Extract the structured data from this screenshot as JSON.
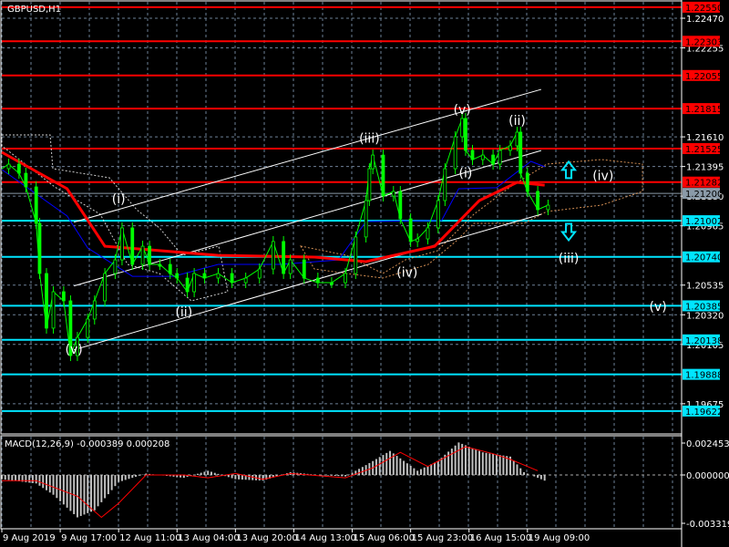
{
  "chart_data": [
    {
      "type": "line",
      "title": "GBPUSD,H1",
      "ylim": [
        1.195,
        1.2277
      ],
      "price_ticks": [
        "1.22470",
        "1.22255",
        "1.21610",
        "1.21395",
        "1.21180",
        "1.20965",
        "1.20535",
        "1.20320",
        "1.20105",
        "1.19675"
      ],
      "resistance_levels": [
        "1.22550",
        "1.22303",
        "1.22055",
        "1.21815",
        "1.21525",
        "1.21282"
      ],
      "support_levels": [
        "1.21002",
        "1.20740",
        "1.20385",
        "1.20138",
        "1.19888",
        "1.19622"
      ],
      "current_price": "1.21200",
      "time_labels": [
        {
          "bar": 0,
          "label": "9 Aug 2019"
        },
        {
          "bar": 17,
          "label": "9 Aug 17:00"
        },
        {
          "bar": 34,
          "label": "12 Aug 11:00"
        },
        {
          "bar": 51,
          "label": "13 Aug 04:00"
        },
        {
          "bar": 68,
          "label": "13 Aug 20:00"
        },
        {
          "bar": 85,
          "label": "14 Aug 13:00"
        },
        {
          "bar": 102,
          "label": "15 Aug 06:00"
        },
        {
          "bar": 119,
          "label": "15 Aug 23:00"
        },
        {
          "bar": 136,
          "label": "16 Aug 15:00"
        },
        {
          "bar": 153,
          "label": "19 Aug 09:00"
        }
      ],
      "price_series": {
        "name": "GBPUSD close",
        "color": "#00ff00",
        "points": [
          [
            0,
            1.21379
          ],
          [
            2,
            1.21412
          ],
          [
            5,
            1.21346
          ],
          [
            7,
            1.21247
          ],
          [
            10,
            1.20983
          ],
          [
            11,
            1.20619
          ],
          [
            13,
            1.20223
          ],
          [
            15,
            1.20487
          ],
          [
            18,
            1.20421
          ],
          [
            20,
            1.20024
          ],
          [
            22,
            1.20156
          ],
          [
            25,
            1.20289
          ],
          [
            27,
            1.20421
          ],
          [
            30,
            1.20619
          ],
          [
            33,
            1.20718
          ],
          [
            35,
            1.2095
          ],
          [
            38,
            1.20685
          ],
          [
            41,
            1.20817
          ],
          [
            43,
            1.20685
          ],
          [
            46,
            1.20685
          ],
          [
            49,
            1.20619
          ],
          [
            51,
            1.20586
          ],
          [
            54,
            1.20487
          ],
          [
            56,
            1.20619
          ],
          [
            59,
            1.20586
          ],
          [
            63,
            1.20619
          ],
          [
            67,
            1.20553
          ],
          [
            71,
            1.20586
          ],
          [
            75,
            1.20652
          ],
          [
            79,
            1.20851
          ],
          [
            82,
            1.20619
          ],
          [
            84,
            1.20718
          ],
          [
            88,
            1.20586
          ],
          [
            92,
            1.20553
          ],
          [
            96,
            1.20553
          ],
          [
            100,
            1.20619
          ],
          [
            103,
            1.20884
          ],
          [
            106,
            1.21148
          ],
          [
            107,
            1.21379
          ],
          [
            108,
            1.21478
          ],
          [
            111,
            1.21181
          ],
          [
            114,
            1.21214
          ],
          [
            116,
            1.21016
          ],
          [
            119,
            1.20851
          ],
          [
            121,
            1.2087
          ],
          [
            124,
            1.2095
          ],
          [
            127,
            1.21148
          ],
          [
            129,
            1.21379
          ],
          [
            132,
            1.21611
          ],
          [
            134,
            1.21743
          ],
          [
            135,
            1.21512
          ],
          [
            137,
            1.21445
          ],
          [
            140,
            1.21478
          ],
          [
            143,
            1.21412
          ],
          [
            145,
            1.21512
          ],
          [
            148,
            1.21545
          ],
          [
            150,
            1.21644
          ],
          [
            151,
            1.21346
          ],
          [
            153,
            1.21214
          ],
          [
            156,
            1.21082
          ],
          [
            159,
            1.21115
          ]
        ]
      },
      "ma_slow": {
        "color": "#ff0000",
        "points": [
          [
            0,
            1.21498
          ],
          [
            19,
            1.21234
          ],
          [
            30,
            1.20817
          ],
          [
            63,
            1.20751
          ],
          [
            91,
            1.20738
          ],
          [
            106,
            1.20705
          ],
          [
            126,
            1.20817
          ],
          [
            139,
            1.21148
          ],
          [
            150,
            1.2128
          ],
          [
            158,
            1.2126
          ]
        ]
      },
      "ma_fast": {
        "color": "#0000ff",
        "points": [
          [
            0,
            1.21373
          ],
          [
            19,
            1.21036
          ],
          [
            25,
            1.20804
          ],
          [
            38,
            1.20599
          ],
          [
            50,
            1.20599
          ],
          [
            63,
            1.20685
          ],
          [
            81,
            1.20685
          ],
          [
            98,
            1.20718
          ],
          [
            106,
            1.20996
          ],
          [
            128,
            1.21003
          ],
          [
            133,
            1.21234
          ],
          [
            144,
            1.21241
          ],
          [
            154,
            1.21432
          ],
          [
            158,
            1.21393
          ]
        ]
      },
      "wave_labels": [
        {
          "text": "(v)",
          "bar": 21,
          "price": 1.2007
        },
        {
          "text": "(i)",
          "bar": 34,
          "price": 1.2116
        },
        {
          "text": "(ii)",
          "bar": 53,
          "price": 1.2034
        },
        {
          "text": "(iii)",
          "bar": 107,
          "price": 1.216
        },
        {
          "text": "(iv)",
          "bar": 118,
          "price": 1.2063
        },
        {
          "text": "(v)",
          "bar": 134,
          "price": 1.2181
        },
        {
          "text": "(i)",
          "bar": 135,
          "price": 1.2135
        },
        {
          "text": "(ii)",
          "bar": 150,
          "price": 1.2173
        },
        {
          "text": "(iii)",
          "bar": 165,
          "price": 1.2073
        },
        {
          "text": "(iv)",
          "bar": 175,
          "price": 1.2133
        },
        {
          "text": "(v)",
          "bar": 191,
          "price": 1.2038
        }
      ],
      "channel_lines": [
        {
          "from": [
            21,
            1.20992
          ],
          "to": [
            157,
            1.21954
          ]
        },
        {
          "from": [
            21,
            1.20529
          ],
          "to": [
            157,
            1.21511
          ]
        },
        {
          "from": [
            21,
            1.20066
          ],
          "to": [
            157,
            1.21049
          ]
        }
      ],
      "arrows": [
        {
          "direction": "up",
          "bar": 165,
          "price": 1.2137,
          "color": "#00e5ff"
        },
        {
          "direction": "down",
          "bar": 165,
          "price": 1.2092,
          "color": "#00e5ff"
        }
      ]
    },
    {
      "type": "bar",
      "title": "MACD(12,26,9) -0.000389 0.000208",
      "ylim": [
        -0.003319,
        0.002453
      ],
      "tick_labels": [
        "0.002453",
        "0.000000",
        "-0.003319"
      ],
      "histogram": {
        "color": "#c0c0c0",
        "points": [
          [
            0,
            -0.0003
          ],
          [
            10,
            -0.0006
          ],
          [
            15,
            -0.0014
          ],
          [
            22,
            -0.003
          ],
          [
            27,
            -0.0025
          ],
          [
            34,
            -0.0005
          ],
          [
            42,
            0.0001
          ],
          [
            53,
            -0.0002
          ],
          [
            60,
            0.0003
          ],
          [
            68,
            -0.0003
          ],
          [
            76,
            -0.0004
          ],
          [
            84,
            0.0002
          ],
          [
            92,
            0.0
          ],
          [
            100,
            -0.0001
          ],
          [
            106,
            0.0007
          ],
          [
            113,
            0.0017
          ],
          [
            117,
            0.001
          ],
          [
            121,
            0.0003
          ],
          [
            127,
            0.001
          ],
          [
            133,
            0.0023
          ],
          [
            140,
            0.0016
          ],
          [
            148,
            0.0013
          ],
          [
            152,
            0.0002
          ],
          [
            158,
            -0.0004
          ]
        ]
      },
      "signal": {
        "color": "#ff0000",
        "points": [
          [
            0,
            -0.0004
          ],
          [
            10,
            -0.0004
          ],
          [
            22,
            -0.0015
          ],
          [
            29,
            -0.003
          ],
          [
            34,
            -0.002
          ],
          [
            42,
            0.0
          ],
          [
            53,
            0.0
          ],
          [
            60,
            -0.0002
          ],
          [
            68,
            0.0001
          ],
          [
            76,
            -0.0003
          ],
          [
            84,
            0.0001
          ],
          [
            100,
            -0.0002
          ],
          [
            108,
            0.0005
          ],
          [
            116,
            0.0016
          ],
          [
            124,
            0.0006
          ],
          [
            135,
            0.002
          ],
          [
            143,
            0.0015
          ],
          [
            148,
            0.0011
          ],
          [
            156,
            0.0003
          ]
        ]
      }
    }
  ]
}
